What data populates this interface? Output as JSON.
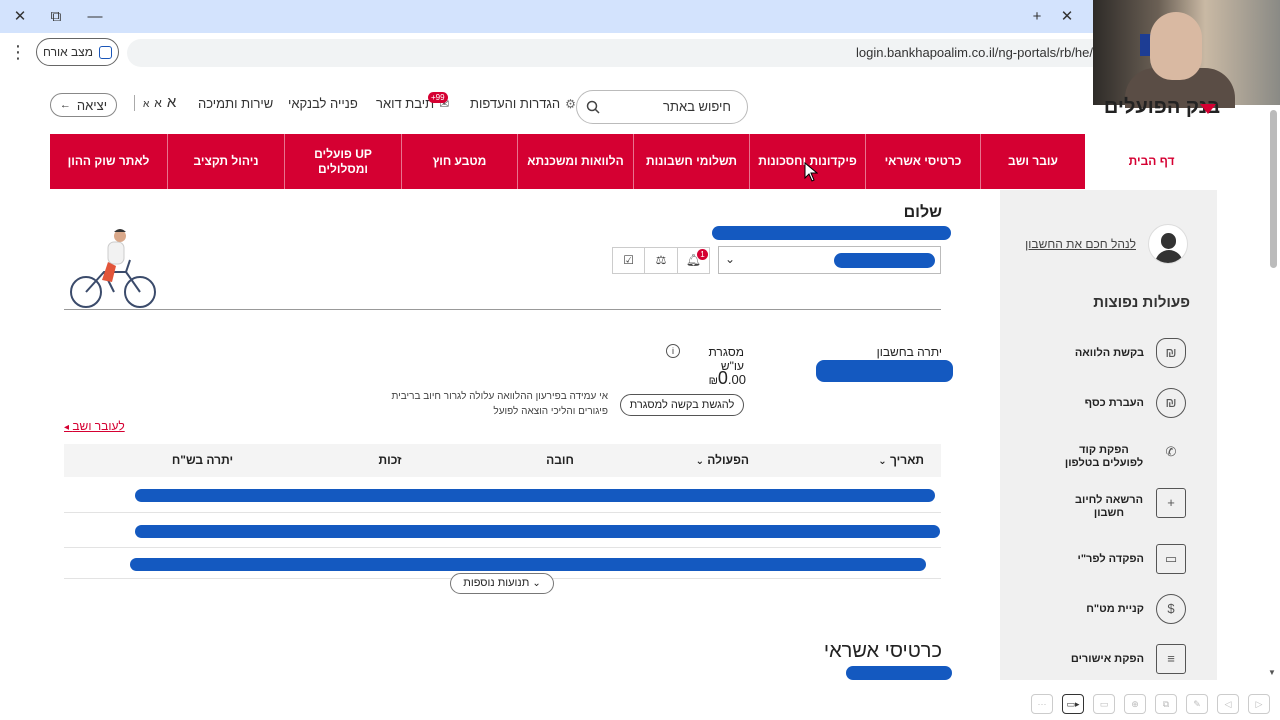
{
  "browser": {
    "url": "login.bankhapoalim.co.il/ng-portals/rb/he/",
    "guest_label": "מצב אורח",
    "menu_icon": "kebab-menu-icon",
    "window_controls": [
      "close-icon",
      "restore-icon",
      "minimize-icon"
    ],
    "tab_controls": [
      "new-tab-icon",
      "close-tab-icon"
    ]
  },
  "header": {
    "logo_text": "בנק הפועלים",
    "search_placeholder": "חיפוש באתר",
    "settings_label": "הגדרות והעדפות",
    "mailbox_label": "תיבת דואר",
    "mailbox_badge": "+99",
    "contact_label": "פנייה לבנקאי",
    "service_label": "שירות ותמיכה",
    "font_large": "א",
    "font_medium": "א",
    "font_small": "א",
    "exit_label": "יציאה",
    "brand_color": "#d50032"
  },
  "nav": {
    "items": [
      {
        "label": "דף הבית",
        "active": true
      },
      {
        "label": "עובר ושב"
      },
      {
        "label": "כרטיסי אשראי"
      },
      {
        "label": "פיקדונות וחסכונות"
      },
      {
        "label": "תשלומי חשבונות"
      },
      {
        "label": "הלוואות ומשכנתא"
      },
      {
        "label": "מטבע חוץ"
      },
      {
        "label": "פועלים UP ומסלולים"
      },
      {
        "label": "ניהול תקציב"
      },
      {
        "label": "לאתר שוק ההון"
      }
    ]
  },
  "sidebar": {
    "manage_link": "לנהל חכם את החשבון",
    "actions_title": "פעולות נפוצות",
    "actions": [
      {
        "label": "בקשת הלוואה",
        "icon": "loan-bag-icon",
        "glyph": "₪"
      },
      {
        "label": "העברת כסף",
        "icon": "money-transfer-icon",
        "glyph": "₪"
      },
      {
        "label": "הפקת קוד לפועלים בטלפון",
        "icon": "phone-code-icon",
        "glyph": "✆"
      },
      {
        "label": "הרשאה לחיוב חשבון",
        "icon": "debit-authorization-icon",
        "glyph": "+"
      },
      {
        "label": "הפקדה לפר\"י",
        "icon": "deposit-icon",
        "glyph": "▭"
      },
      {
        "label": "קניית מט\"ח",
        "icon": "foreign-currency-icon",
        "glyph": "$"
      },
      {
        "label": "הפקת אישורים",
        "icon": "certificates-icon",
        "glyph": "≡"
      }
    ]
  },
  "main": {
    "greeting": "שלום",
    "balance_label": "יתרה בחשבון",
    "credit_label": "מסגרת עו\"ש",
    "credit_amount_main": "0",
    "credit_amount_decimals": ".00",
    "currency": "₪",
    "credit_button": "להגשת בקשה למסגרת",
    "credit_note": "אי עמידה בפירעון ההלוואה עלולה לגרור חיוב בריבית פיגורים והליכי הוצאה לפועל",
    "to_current_account": "לעובר ושב",
    "table": {
      "columns": [
        "תאריך",
        "הפעולה",
        "חובה",
        "זכות",
        "יתרה בש\"ח"
      ]
    },
    "more_transactions": "תנועות נוספות",
    "cards_title": "כרטיסי אשראי"
  },
  "bottom_toolbar": [
    "more-icon",
    "video-icon",
    "screen-icon",
    "zoom-icon",
    "copy-icon",
    "pen-icon",
    "back-icon",
    "forward-icon"
  ]
}
